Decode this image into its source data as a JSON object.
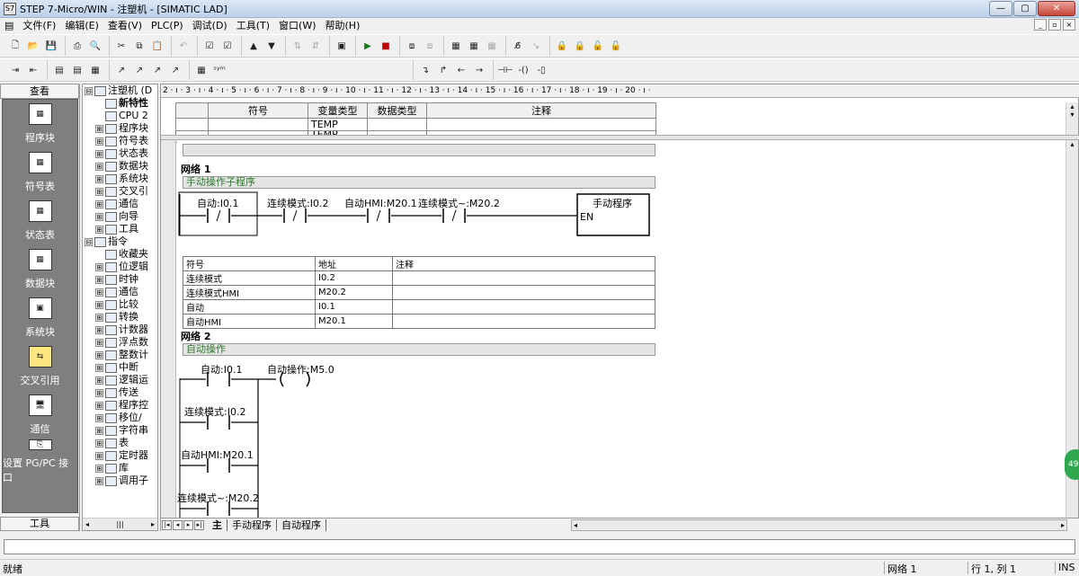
{
  "window": {
    "title": "STEP 7-Micro/WIN - 注塑机 - [SIMATIC LAD]",
    "min": "—",
    "max": "▢",
    "close": "✕"
  },
  "menu": [
    "文件(F)",
    "编辑(E)",
    "查看(V)",
    "PLC(P)",
    "调试(D)",
    "工具(T)",
    "窗口(W)",
    "帮助(H)"
  ],
  "nav": {
    "header": "查看",
    "footer": "工具",
    "items": [
      "程序块",
      "符号表",
      "状态表",
      "数据块",
      "系统块",
      "交叉引用",
      "通信",
      "设置 PG/PC 接口"
    ]
  },
  "tree": [
    {
      "exp": "⊟",
      "label": "注塑机 (D",
      "bold": false
    },
    {
      "exp": "",
      "label": "新特性",
      "bold": true
    },
    {
      "exp": "",
      "label": "CPU 2",
      "bold": false
    },
    {
      "exp": "⊞",
      "label": "程序块",
      "bold": false
    },
    {
      "exp": "⊞",
      "label": "符号表",
      "bold": false
    },
    {
      "exp": "⊞",
      "label": "状态表",
      "bold": false
    },
    {
      "exp": "⊞",
      "label": "数据块",
      "bold": false
    },
    {
      "exp": "⊞",
      "label": "系统块",
      "bold": false
    },
    {
      "exp": "⊞",
      "label": "交叉引",
      "bold": false
    },
    {
      "exp": "⊞",
      "label": "通信",
      "bold": false
    },
    {
      "exp": "⊞",
      "label": "向导",
      "bold": false
    },
    {
      "exp": "⊞",
      "label": "工具",
      "bold": false
    },
    {
      "exp": "⊟",
      "label": "指令",
      "bold": false
    },
    {
      "exp": "",
      "label": "收藏夹",
      "bold": false
    },
    {
      "exp": "⊞",
      "label": "位逻辑",
      "bold": false
    },
    {
      "exp": "⊞",
      "label": "时钟",
      "bold": false
    },
    {
      "exp": "⊞",
      "label": "通信",
      "bold": false
    },
    {
      "exp": "⊞",
      "label": "比较",
      "bold": false
    },
    {
      "exp": "⊞",
      "label": "转换",
      "bold": false
    },
    {
      "exp": "⊞",
      "label": "计数器",
      "bold": false
    },
    {
      "exp": "⊞",
      "label": "浮点数",
      "bold": false
    },
    {
      "exp": "⊞",
      "label": "整数计",
      "bold": false
    },
    {
      "exp": "⊞",
      "label": "中断",
      "bold": false
    },
    {
      "exp": "⊞",
      "label": "逻辑运",
      "bold": false
    },
    {
      "exp": "⊞",
      "label": "传送",
      "bold": false
    },
    {
      "exp": "⊞",
      "label": "程序控",
      "bold": false
    },
    {
      "exp": "⊞",
      "label": "移位/",
      "bold": false
    },
    {
      "exp": "⊞",
      "label": "字符串",
      "bold": false
    },
    {
      "exp": "⊞",
      "label": "表",
      "bold": false
    },
    {
      "exp": "⊞",
      "label": "定时器",
      "bold": false
    },
    {
      "exp": "⊞",
      "label": "库",
      "bold": false
    },
    {
      "exp": "⊞",
      "label": "调用子",
      "bold": false
    }
  ],
  "ruler": "2 · ı · 3 · ı · 4 · ı · 5 · ı · 6 · ı · 7 · ı · 8 · ı · 9 · ı · 10 · ı · 11 · ı · 12 · ı · 13 · ı · 14 · ı · 15 · ı · 16 · ı · 17 · ı · 18 · ı · 19 · ı · 20 · ı ·",
  "vartable": {
    "headers": [
      "符号",
      "变量类型",
      "数据类型",
      "注释"
    ],
    "rows": [
      [
        "",
        "TEMP",
        "",
        ""
      ],
      [
        "",
        "TEMP",
        "",
        ""
      ]
    ]
  },
  "network1": {
    "title": "网络 1",
    "comment": "手动操作子程序",
    "contacts": [
      "自动:I0.1",
      "连续模式:I0.2",
      "自动HMI:M20.1",
      "连续模式~:M20.2"
    ],
    "box_title": "手动程序",
    "box_pin": "EN",
    "symtab": {
      "headers": [
        "符号",
        "地址",
        "注释"
      ],
      "rows": [
        [
          "连续模式",
          "I0.2",
          ""
        ],
        [
          "连续模式HMI",
          "M20.2",
          ""
        ],
        [
          "自动",
          "I0.1",
          ""
        ],
        [
          "自动HMI",
          "M20.1",
          ""
        ]
      ]
    }
  },
  "network2": {
    "title": "网络 2",
    "comment": "自动操作",
    "contacts": [
      "自动:I0.1",
      "连续模式:I0.2",
      "自动HMI:M20.1",
      "连续模式~:M20.2"
    ],
    "coil": "自动操作:M5.0"
  },
  "tabs": [
    "主",
    "手动程序",
    "自动程序"
  ],
  "status": {
    "left": "就绪",
    "network": "网络 1",
    "pos": "行 1, 列 1",
    "mode": "INS"
  },
  "bubble": "49"
}
